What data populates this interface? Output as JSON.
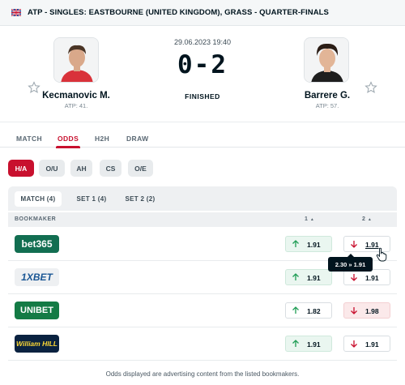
{
  "breadcrumb": {
    "text": "ATP - SINGLES: EASTBOURNE (UNITED KINGDOM), GRASS - QUARTER-FINALS",
    "flag_icon": "uk-flag-icon"
  },
  "match": {
    "datetime": "29.06.2023 19:40",
    "score": "0-2",
    "status": "FINISHED",
    "home": {
      "name": "Kecmanovic M.",
      "rank": "ATP: 41.",
      "favorite_icon": "star-icon"
    },
    "away": {
      "name": "Barrere G.",
      "rank": "ATP: 57.",
      "favorite_icon": "star-icon"
    }
  },
  "tabs": [
    {
      "label": "MATCH",
      "active": false
    },
    {
      "label": "ODDS",
      "active": true
    },
    {
      "label": "H2H",
      "active": false
    },
    {
      "label": "DRAW",
      "active": false
    }
  ],
  "odds_types": [
    {
      "label": "H/A",
      "active": true
    },
    {
      "label": "O/U",
      "active": false
    },
    {
      "label": "AH",
      "active": false
    },
    {
      "label": "CS",
      "active": false
    },
    {
      "label": "O/E",
      "active": false
    }
  ],
  "periods": [
    {
      "label": "MATCH (4)",
      "active": true
    },
    {
      "label": "SET 1 (4)",
      "active": false
    },
    {
      "label": "SET 2 (2)",
      "active": false
    }
  ],
  "columns": {
    "bookmaker": "BOOKMAKER",
    "home": "1",
    "away": "2",
    "sort_icon": "sort-arrow-icon"
  },
  "bookmakers": [
    {
      "name": "bet365",
      "odd1": "1.91",
      "odd1_trend": "up",
      "odd2": "1.91",
      "odd2_trend": "down",
      "colors": {
        "bg": "#126e51",
        "fg": "#ffffff",
        "accent": "#ffdf1b"
      }
    },
    {
      "name": "1XBET",
      "odd1": "1.91",
      "odd1_trend": "up",
      "odd2": "1.91",
      "odd2_trend": "down",
      "colors": {
        "bg": "#eef0f2",
        "fg": "#1a5694"
      }
    },
    {
      "name": "UNIBET",
      "odd1": "1.82",
      "odd1_trend": "up",
      "odd2": "1.98",
      "odd2_trend": "down",
      "colors": {
        "bg": "#147b45",
        "fg": "#ffffff"
      }
    },
    {
      "name": "William HILL",
      "odd1": "1.91",
      "odd1_trend": "up",
      "odd2": "1.91",
      "odd2_trend": "down",
      "colors": {
        "bg": "#0a2240",
        "fg": "#fdd835"
      }
    }
  ],
  "tooltip": {
    "text": "2.30 » 1.91"
  },
  "footer": {
    "text": "Odds displayed are advertising content from the listed bookmakers."
  },
  "colors": {
    "accent": "#c8102e",
    "up": "#1f9d55",
    "down": "#c8102e"
  }
}
